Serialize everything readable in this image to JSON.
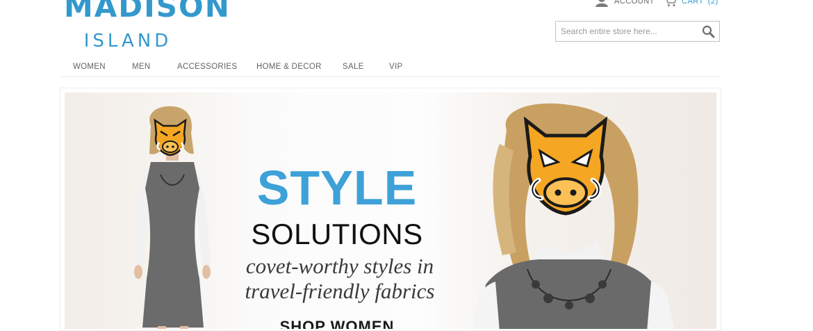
{
  "header": {
    "logo": {
      "main": "MADISON",
      "sub": "ISLAND"
    },
    "account_label": "ACCOUNT",
    "cart_label": "CART",
    "cart_count": "(2)",
    "search": {
      "placeholder": "Search entire store here...",
      "value": ""
    },
    "icons": {
      "account": "person-icon",
      "cart": "cart-icon",
      "search": "magnifier-icon"
    }
  },
  "nav": {
    "items": [
      {
        "label": "WOMEN"
      },
      {
        "label": "MEN"
      },
      {
        "label": "ACCESSORIES"
      },
      {
        "label": "HOME & DECOR"
      },
      {
        "label": "SALE"
      },
      {
        "label": "VIP"
      }
    ]
  },
  "banner": {
    "headline": "STYLE",
    "subhead": "SOLUTIONS",
    "tagline_line1": "covet-worthy styles in",
    "tagline_line2": "travel-friendly fabrics",
    "cta": "SHOP WOMEN"
  },
  "colors": {
    "brand": "#3399cc",
    "headline": "#3ea1d8",
    "mascot_orange": "#f5a623",
    "mascot_outline": "#1a1a1a"
  }
}
